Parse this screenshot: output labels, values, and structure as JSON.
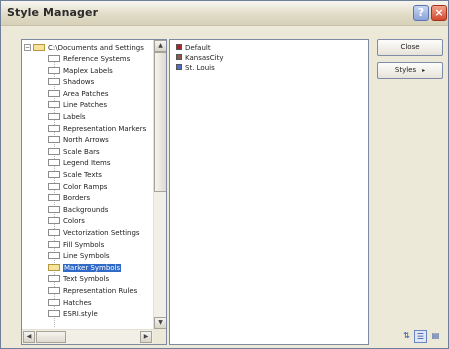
{
  "window": {
    "title": "Style Manager"
  },
  "titlebar": {
    "help_glyph": "?",
    "close_glyph": "×"
  },
  "tree": {
    "root_expander": "−",
    "root_label": "C:\\Documents and Settings",
    "items": [
      {
        "label": "Reference Systems"
      },
      {
        "label": "Maplex Labels"
      },
      {
        "label": "Shadows"
      },
      {
        "label": "Area Patches"
      },
      {
        "label": "Line Patches"
      },
      {
        "label": "Labels"
      },
      {
        "label": "Representation Markers"
      },
      {
        "label": "North Arrows"
      },
      {
        "label": "Scale Bars"
      },
      {
        "label": "Legend Items"
      },
      {
        "label": "Scale Texts"
      },
      {
        "label": "Color Ramps"
      },
      {
        "label": "Borders"
      },
      {
        "label": "Backgrounds"
      },
      {
        "label": "Colors"
      },
      {
        "label": "Vectorization Settings"
      },
      {
        "label": "Fill Symbols"
      },
      {
        "label": "Line Symbols"
      },
      {
        "label": "Marker Symbols",
        "selected": true
      },
      {
        "label": "Text Symbols"
      },
      {
        "label": "Representation Rules"
      },
      {
        "label": "Hatches"
      },
      {
        "label": "ESRI.style"
      }
    ]
  },
  "list": {
    "items": [
      {
        "label": "Default",
        "color": "#b0202a"
      },
      {
        "label": "KansasCity",
        "color": "#8a5a4a"
      },
      {
        "label": "St. Louis",
        "color": "#4f6fc4"
      }
    ]
  },
  "buttons": {
    "close_label": "Close",
    "styles_label": "Styles",
    "styles_caret": "▸"
  },
  "view_buttons": {
    "sort_glyph": "⇅",
    "list_glyph": "☰",
    "detail_glyph": "▤"
  },
  "scroll": {
    "up": "▲",
    "down": "▼",
    "left": "◀",
    "right": "▶"
  }
}
